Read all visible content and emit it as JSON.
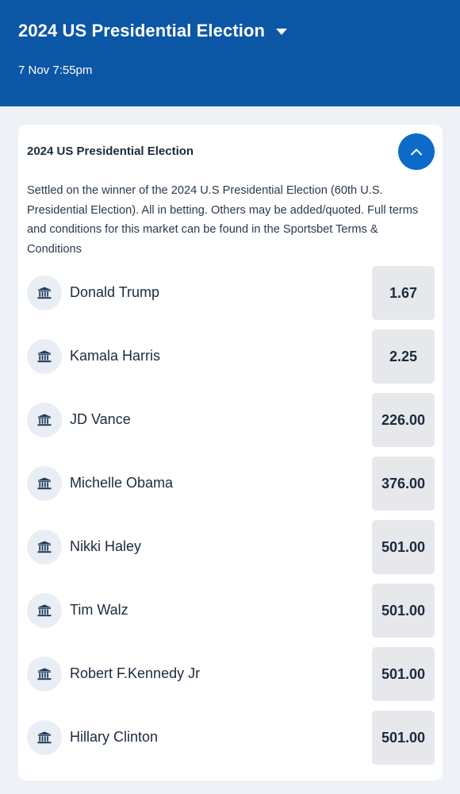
{
  "header": {
    "title": "2024 US Presidential Election",
    "datetime": "7 Nov 7:55pm"
  },
  "market": {
    "title": "2024 US Presidential Election",
    "description": "Settled on the winner of the 2024 U.S Presidential Election (60th U.S. Presidential Election). All in betting. Others may be added/quoted. Full terms and conditions for this market can be found in the Sportsbet Terms & Conditions",
    "runners": [
      {
        "name": "Donald Trump",
        "odds": "1.67",
        "icon": "government-building-icon"
      },
      {
        "name": "Kamala Harris",
        "odds": "2.25",
        "icon": "government-building-icon"
      },
      {
        "name": "JD Vance",
        "odds": "226.00",
        "icon": "government-building-icon"
      },
      {
        "name": "Michelle Obama",
        "odds": "376.00",
        "icon": "government-building-icon"
      },
      {
        "name": "Nikki Haley",
        "odds": "501.00",
        "icon": "government-building-icon"
      },
      {
        "name": "Tim Walz",
        "odds": "501.00",
        "icon": "government-building-icon"
      },
      {
        "name": "Robert F.Kennedy Jr",
        "odds": "501.00",
        "icon": "government-building-icon"
      },
      {
        "name": "Hillary Clinton",
        "odds": "501.00",
        "icon": "government-building-icon"
      }
    ]
  },
  "colors": {
    "header_bg": "#0c56a6",
    "accent": "#0c6ac9",
    "page_bg": "#eef2f7",
    "odds_bg": "#e6e8ec"
  }
}
